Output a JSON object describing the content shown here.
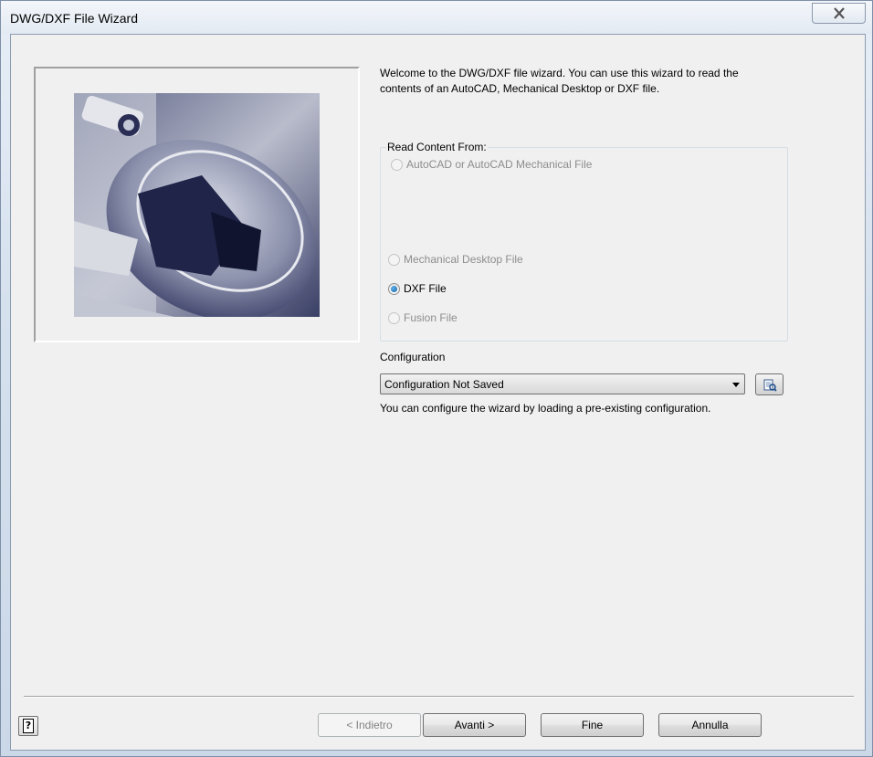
{
  "window": {
    "title": "DWG/DXF File Wizard"
  },
  "welcome_text": {
    "line1": "Welcome to the DWG/DXF file wizard. You can use this wizard to read the",
    "line2": "contents of an AutoCAD, Mechanical Desktop or DXF file."
  },
  "read_content": {
    "legend": "Read Content From:",
    "options": [
      {
        "label": "AutoCAD or AutoCAD Mechanical File",
        "enabled": false,
        "checked": false
      },
      {
        "label": "Mechanical Desktop File",
        "enabled": false,
        "checked": false
      },
      {
        "label": "DXF File",
        "enabled": true,
        "checked": true
      },
      {
        "label": "Fusion File",
        "enabled": false,
        "checked": false
      }
    ]
  },
  "configuration": {
    "label": "Configuration",
    "selected": "Configuration Not Saved",
    "hint": "You can configure the wizard by loading a pre-existing configuration."
  },
  "buttons": {
    "back": "< Indietro",
    "next": "Avanti >",
    "finish": "Fine",
    "cancel": "Annulla",
    "help": "?"
  },
  "icons": {
    "close": "close-icon",
    "help": "help-icon",
    "browse": "open-config-icon"
  }
}
